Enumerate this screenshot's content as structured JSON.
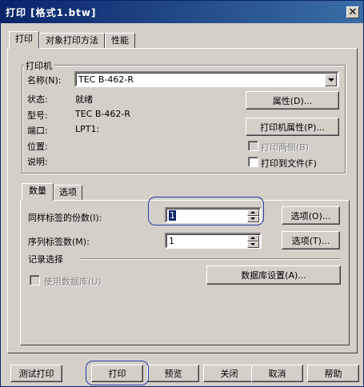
{
  "window": {
    "title": "打印 [格式1.btw]"
  },
  "tabs": [
    {
      "label": "打印"
    },
    {
      "label": "对象打印方法"
    },
    {
      "label": "性能"
    }
  ],
  "printer": {
    "group_label": "打印机",
    "name_label": "名称(N):",
    "name_value": "TEC B-462-R",
    "status_label": "状态:",
    "status_value": "就绪",
    "model_label": "型号:",
    "model_value": "TEC B-462-R",
    "port_label": "端口:",
    "port_value": "LPT1:",
    "location_label": "位置:",
    "comment_label": "说明:",
    "properties_button": "属性(D)...",
    "printer_properties_button": "打印机属性(P)...",
    "print_duplex_label": "打印两侧(B)",
    "print_to_file_label": "打印到文件(F)"
  },
  "subtabs": [
    {
      "label": "数量"
    },
    {
      "label": "选项"
    }
  ],
  "quantity": {
    "copies_label": "同样标签的份数(I):",
    "copies_value": "1",
    "copies_options_button": "选项(O)...",
    "serial_label": "序列标签数(M):",
    "serial_value": "1",
    "serial_options_button": "选项(T)...",
    "record_selection_label": "记录选择",
    "use_database_label": "使用数据库(U)",
    "database_setup_button": "数据库设置(A)..."
  },
  "footer": {
    "test_print": "测试打印",
    "print": "打印",
    "preview": "预览",
    "close": "关闭",
    "cancel": "取消",
    "help": "帮助"
  }
}
